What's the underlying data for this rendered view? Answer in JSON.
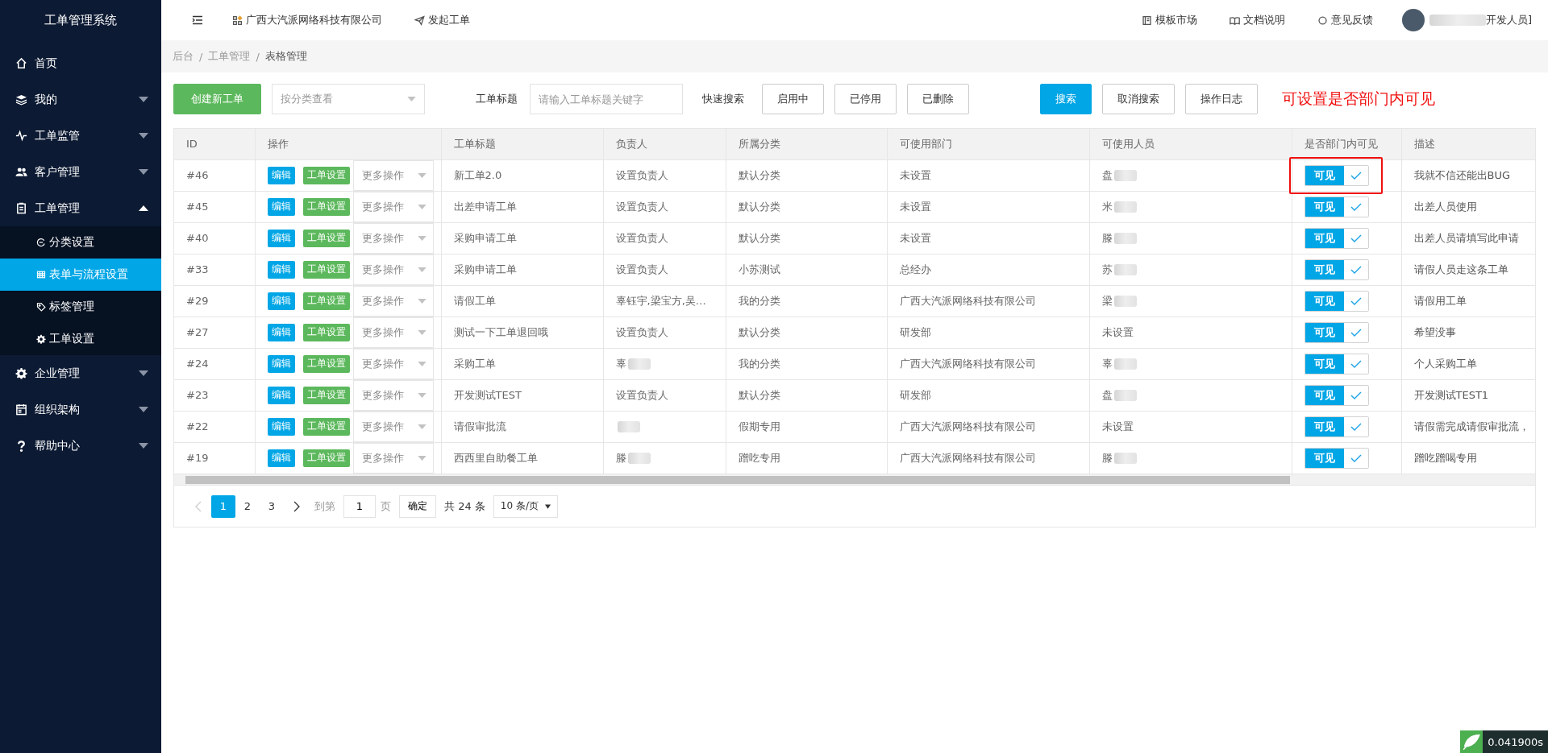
{
  "sidebar": {
    "title": "工单管理系统",
    "items": [
      {
        "label": "首页",
        "has_children": false
      },
      {
        "label": "我的",
        "has_children": true,
        "expanded": false
      },
      {
        "label": "工单监管",
        "has_children": true,
        "expanded": false
      },
      {
        "label": "客户管理",
        "has_children": true,
        "expanded": false
      },
      {
        "label": "工单管理",
        "has_children": true,
        "expanded": true,
        "children": [
          {
            "label": "分类设置",
            "selected": false
          },
          {
            "label": "表单与流程设置",
            "selected": true
          },
          {
            "label": "标签管理",
            "selected": false
          },
          {
            "label": "工单设置",
            "selected": false
          }
        ]
      },
      {
        "label": "企业管理",
        "has_children": true,
        "expanded": false
      },
      {
        "label": "组织架构",
        "has_children": true,
        "expanded": false
      },
      {
        "label": "帮助中心",
        "has_children": true,
        "expanded": false
      }
    ]
  },
  "header": {
    "left": [
      "广西大汽派网络科技有限公司",
      "发起工单"
    ],
    "right": [
      "模板市场",
      "文档说明",
      "意见反馈"
    ],
    "user": {
      "name": "开发人员]",
      "blurred": true
    }
  },
  "breadcrumb": [
    {
      "label": "后台"
    },
    {
      "sep": "/",
      "label": "工单管理"
    },
    {
      "sep": "/",
      "label": "表格管理"
    }
  ],
  "toolbar": {
    "create_button": "创建新工单",
    "category_select": {
      "placeholder": "按分类查看"
    },
    "title_label": "工单标题",
    "title_input": {
      "placeholder": "请输入工单标题关键字"
    },
    "quick_label": "快速搜索",
    "quick_filters": [
      "启用中",
      "已停用",
      "已删除"
    ],
    "search_button": "搜索",
    "cancel_button": "取消搜索",
    "log_button": "操作日志"
  },
  "annotation": "可设置是否部门内可见",
  "table": {
    "columns": [
      "ID",
      "操作",
      "工单标题",
      "负责人",
      "所属分类",
      "可使用部门",
      "可使用人员",
      "是否部门内可见",
      "描述"
    ],
    "rows": [
      {
        "id": "#46",
        "edit": "编辑",
        "settings": "工单设置",
        "more": "更多操作",
        "title": "新工单2.0",
        "owner": {
          "text": "设置负责人",
          "blurred": false
        },
        "category": "默认分类",
        "dept": "未设置",
        "people": {
          "text": "盘",
          "blurred": true
        },
        "visible_label": "可见",
        "visible": true,
        "highlighted": true,
        "desc": "我就不信还能出BUG"
      },
      {
        "id": "#45",
        "edit": "编辑",
        "settings": "工单设置",
        "more": "更多操作",
        "title": "出差申请工单",
        "owner": {
          "text": "设置负责人",
          "blurred": false
        },
        "category": "默认分类",
        "dept": "未设置",
        "people": {
          "text": "米",
          "blurred": true
        },
        "visible_label": "可见",
        "visible": true,
        "highlighted": false,
        "desc": "出差人员使用"
      },
      {
        "id": "#40",
        "edit": "编辑",
        "settings": "工单设置",
        "more": "更多操作",
        "title": "采购申请工单",
        "owner": {
          "text": "设置负责人",
          "blurred": false
        },
        "category": "默认分类",
        "dept": "未设置",
        "people": {
          "text": "滕",
          "blurred": true
        },
        "visible_label": "可见",
        "visible": true,
        "highlighted": false,
        "desc": "出差人员请填写此申请"
      },
      {
        "id": "#33",
        "edit": "编辑",
        "settings": "工单设置",
        "more": "更多操作",
        "title": "采购申请工单",
        "owner": {
          "text": "设置负责人",
          "blurred": false
        },
        "category": "小苏测试",
        "dept": "总经办",
        "people": {
          "text": "苏",
          "blurred": true
        },
        "visible_label": "可见",
        "visible": true,
        "highlighted": false,
        "desc": "请假人员走这条工单"
      },
      {
        "id": "#29",
        "edit": "编辑",
        "settings": "工单设置",
        "more": "更多操作",
        "title": "请假工单",
        "owner": {
          "text": "辜钰宇,梁宝方,吴…",
          "blurred": false
        },
        "category": "我的分类",
        "dept": "广西大汽派网络科技有限公司",
        "people": {
          "text": "梁",
          "blurred": true
        },
        "visible_label": "可见",
        "visible": true,
        "highlighted": false,
        "desc": "请假用工单"
      },
      {
        "id": "#27",
        "edit": "编辑",
        "settings": "工单设置",
        "more": "更多操作",
        "title": "测试一下工单退回哦",
        "owner": {
          "text": "设置负责人",
          "blurred": false
        },
        "category": "默认分类",
        "dept": "研发部",
        "people": {
          "text": "未设置",
          "blurred": false
        },
        "visible_label": "可见",
        "visible": true,
        "highlighted": false,
        "desc": "希望没事"
      },
      {
        "id": "#24",
        "edit": "编辑",
        "settings": "工单设置",
        "more": "更多操作",
        "title": "采购工单",
        "owner": {
          "text": "辜",
          "blurred": true
        },
        "category": "我的分类",
        "dept": "广西大汽派网络科技有限公司",
        "people": {
          "text": "辜",
          "blurred": true
        },
        "visible_label": "可见",
        "visible": true,
        "highlighted": false,
        "desc": "个人采购工单"
      },
      {
        "id": "#23",
        "edit": "编辑",
        "settings": "工单设置",
        "more": "更多操作",
        "title": "开发测试TEST",
        "owner": {
          "text": "设置负责人",
          "blurred": false
        },
        "category": "默认分类",
        "dept": "研发部",
        "people": {
          "text": "盘",
          "blurred": true
        },
        "visible_label": "可见",
        "visible": true,
        "highlighted": false,
        "desc": "开发测试TEST1"
      },
      {
        "id": "#22",
        "edit": "编辑",
        "settings": "工单设置",
        "more": "更多操作",
        "title": "请假审批流",
        "owner": {
          "blurred": true
        },
        "category": "假期专用",
        "dept": "广西大汽派网络科技有限公司",
        "people": {
          "text": "未设置",
          "blurred": false
        },
        "visible_label": "可见",
        "visible": true,
        "highlighted": false,
        "desc": "请假需完成请假审批流，"
      },
      {
        "id": "#19",
        "edit": "编辑",
        "settings": "工单设置",
        "more": "更多操作",
        "title": "西西里自助餐工单",
        "owner": {
          "text": "滕",
          "blurred": true
        },
        "category": "蹭吃专用",
        "dept": "广西大汽派网络科技有限公司",
        "people": {
          "text": "滕",
          "blurred": true
        },
        "visible_label": "可见",
        "visible": true,
        "highlighted": false,
        "desc": "蹭吃蹭喝专用"
      }
    ]
  },
  "pagination": {
    "pages": [
      {
        "label": "1",
        "selected": true
      },
      {
        "label": "2",
        "selected": false
      },
      {
        "label": "3",
        "selected": false
      }
    ],
    "goto_label": "到第",
    "goto_value": "1",
    "page_label": "页",
    "confirm": "确定",
    "total": "共 24 条",
    "page_size": "10 条/页"
  },
  "timer": "0.041900s"
}
